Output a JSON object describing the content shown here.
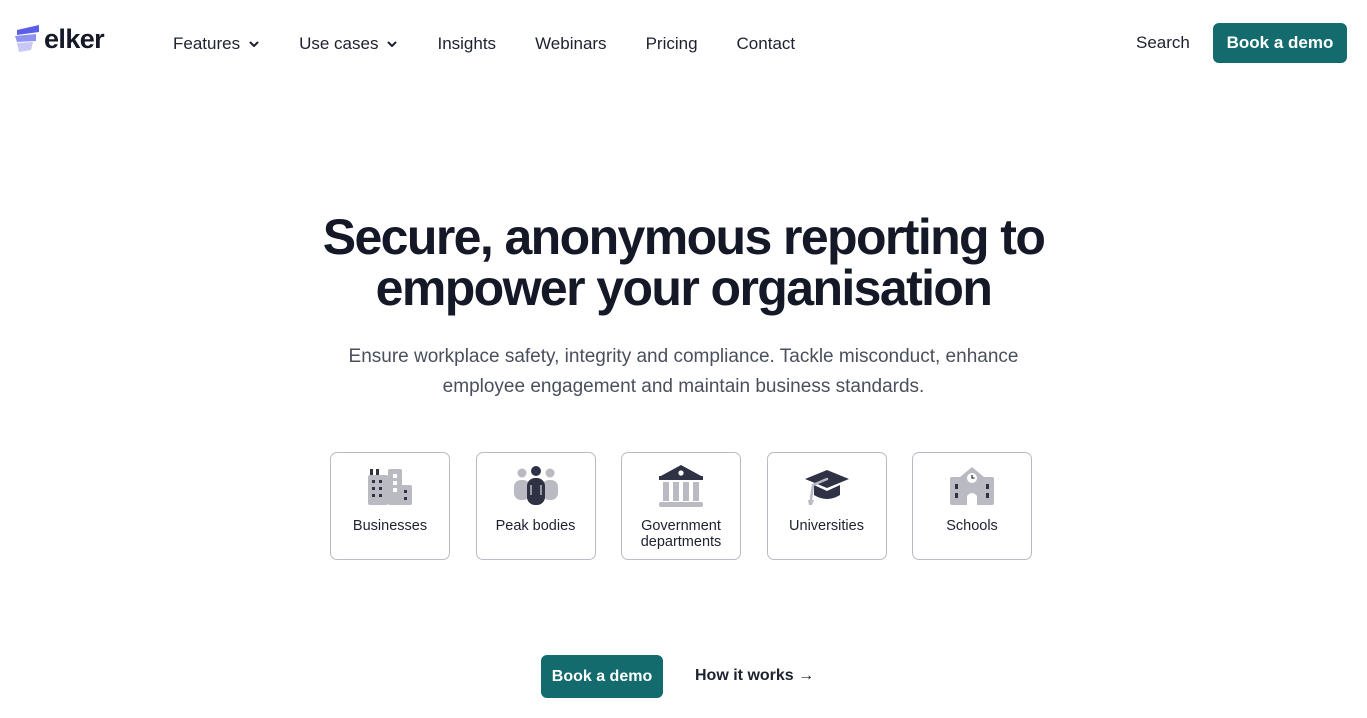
{
  "brand": {
    "name": "elker",
    "accent": "#136b6d",
    "logo_color": "#5b5fe8"
  },
  "nav": {
    "items": [
      {
        "label": "Features",
        "has_dropdown": true
      },
      {
        "label": "Use cases",
        "has_dropdown": true
      },
      {
        "label": "Insights",
        "has_dropdown": false
      },
      {
        "label": "Webinars",
        "has_dropdown": false
      },
      {
        "label": "Pricing",
        "has_dropdown": false
      },
      {
        "label": "Contact",
        "has_dropdown": false
      }
    ],
    "search_label": "Search",
    "cta_label": "Book a demo"
  },
  "hero": {
    "title_line1": "Secure, anonymous reporting to",
    "title_line2": "empower your organisation",
    "subtitle_line1": "Ensure workplace safety, integrity and compliance. Tackle misconduct, enhance",
    "subtitle_line2": "employee engagement and maintain business standards."
  },
  "use_cases": [
    {
      "label": "Businesses",
      "icon": "building-icon"
    },
    {
      "label": "Peak bodies",
      "icon": "group-icon"
    },
    {
      "label": "Government departments",
      "label_line1": "Government",
      "label_line2": "departments",
      "icon": "government-building-icon"
    },
    {
      "label": "Universities",
      "icon": "graduation-cap-icon"
    },
    {
      "label": "Schools",
      "icon": "school-icon"
    }
  ],
  "cta": {
    "primary_label": "Book a demo",
    "secondary_label": "How it works →"
  }
}
